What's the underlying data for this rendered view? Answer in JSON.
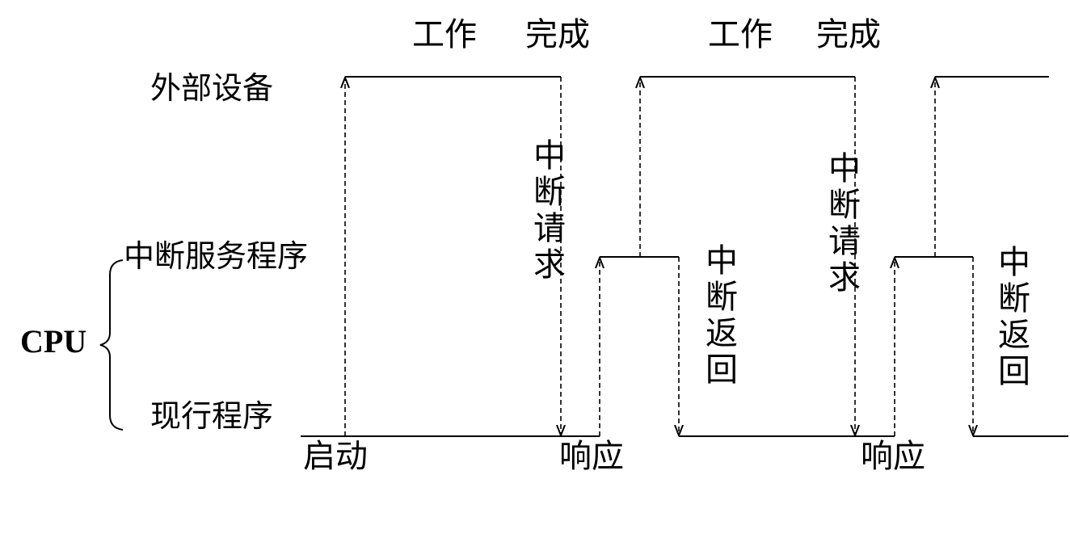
{
  "rows": {
    "device": "外部设备",
    "isr": "中断服务程序",
    "current": "现行程序",
    "cpu": "CPU"
  },
  "top_labels": {
    "work_1": "工作",
    "done_1": "完成",
    "work_2": "工作",
    "done_2": "完成"
  },
  "bottom_labels": {
    "start": "启动",
    "respond_1": "响应",
    "respond_2": "响应"
  },
  "vertical_labels": {
    "interrupt_request": "中断请求",
    "interrupt_return": "中断返回"
  }
}
